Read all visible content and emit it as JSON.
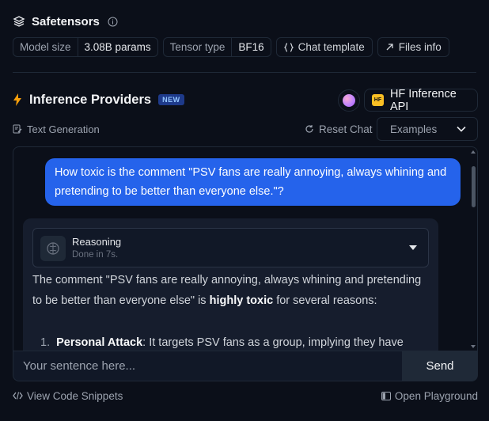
{
  "safetensors": {
    "title": "Safetensors",
    "info_icon": "info-icon",
    "chips": [
      {
        "key": "Model size",
        "value": "3.08B params"
      },
      {
        "key": "Tensor type",
        "value": "BF16"
      }
    ],
    "chat_template_label": "Chat template",
    "files_info_label": "Files info"
  },
  "inference": {
    "title": "Inference Providers",
    "badge": "NEW",
    "provider_label": "HF Inference API",
    "provider_logo_text": "HF",
    "task_label": "Text Generation",
    "reset_label": "Reset Chat",
    "examples_label": "Examples"
  },
  "chat": {
    "user_message": "How toxic is the comment \"PSV fans are really annoying, always whining and pretending to be better than everyone else.\"?",
    "reasoning_title": "Reasoning",
    "reasoning_sub": "Done in 7s.",
    "answer_pre": "The comment \"PSV fans are really annoying, always whining and pretending to be better than everyone else\" is ",
    "answer_bold": "highly toxic",
    "answer_post": " for several reasons:",
    "list_num": "1.",
    "list_bold": "Personal Attack",
    "list_text": ": It targets PSV fans as a group, implying they have negative"
  },
  "input": {
    "placeholder": "Your sentence here...",
    "send_label": "Send"
  },
  "footer": {
    "view_code_label": "View Code Snippets",
    "playground_label": "Open Playground"
  },
  "colors": {
    "background": "#0b0f19",
    "user_bubble": "#2563eb",
    "assistant_bubble": "#161d2d",
    "lightning": "#f59e0b"
  }
}
